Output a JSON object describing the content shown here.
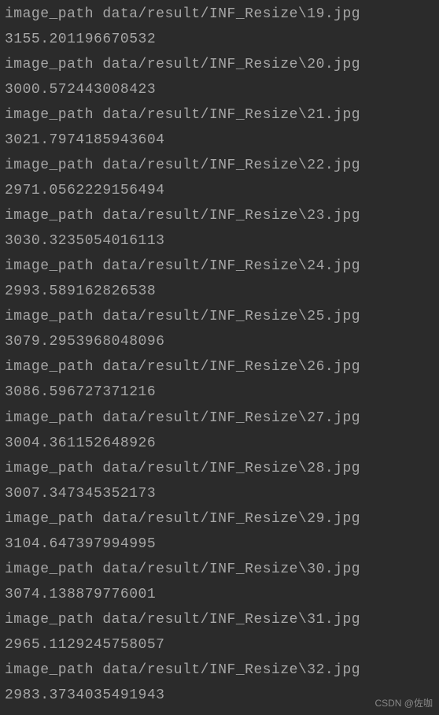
{
  "label_prefix": "image_path ",
  "entries": [
    {
      "path": "data/result/INF_Resize\\19.jpg",
      "value": "3155.201196670532"
    },
    {
      "path": "data/result/INF_Resize\\20.jpg",
      "value": "3000.572443008423"
    },
    {
      "path": "data/result/INF_Resize\\21.jpg",
      "value": "3021.7974185943604"
    },
    {
      "path": "data/result/INF_Resize\\22.jpg",
      "value": "2971.0562229156494"
    },
    {
      "path": "data/result/INF_Resize\\23.jpg",
      "value": "3030.3235054016113"
    },
    {
      "path": "data/result/INF_Resize\\24.jpg",
      "value": "2993.589162826538"
    },
    {
      "path": "data/result/INF_Resize\\25.jpg",
      "value": "3079.2953968048096"
    },
    {
      "path": "data/result/INF_Resize\\26.jpg",
      "value": "3086.596727371216"
    },
    {
      "path": "data/result/INF_Resize\\27.jpg",
      "value": "3004.361152648926"
    },
    {
      "path": "data/result/INF_Resize\\28.jpg",
      "value": "3007.347345352173"
    },
    {
      "path": "data/result/INF_Resize\\29.jpg",
      "value": "3104.647397994995"
    },
    {
      "path": "data/result/INF_Resize\\30.jpg",
      "value": "3074.138879776001"
    },
    {
      "path": "data/result/INF_Resize\\31.jpg",
      "value": "2965.1129245758057"
    },
    {
      "path": "data/result/INF_Resize\\32.jpg",
      "value": "2983.3734035491943"
    }
  ],
  "watermark": "CSDN @佐咖"
}
